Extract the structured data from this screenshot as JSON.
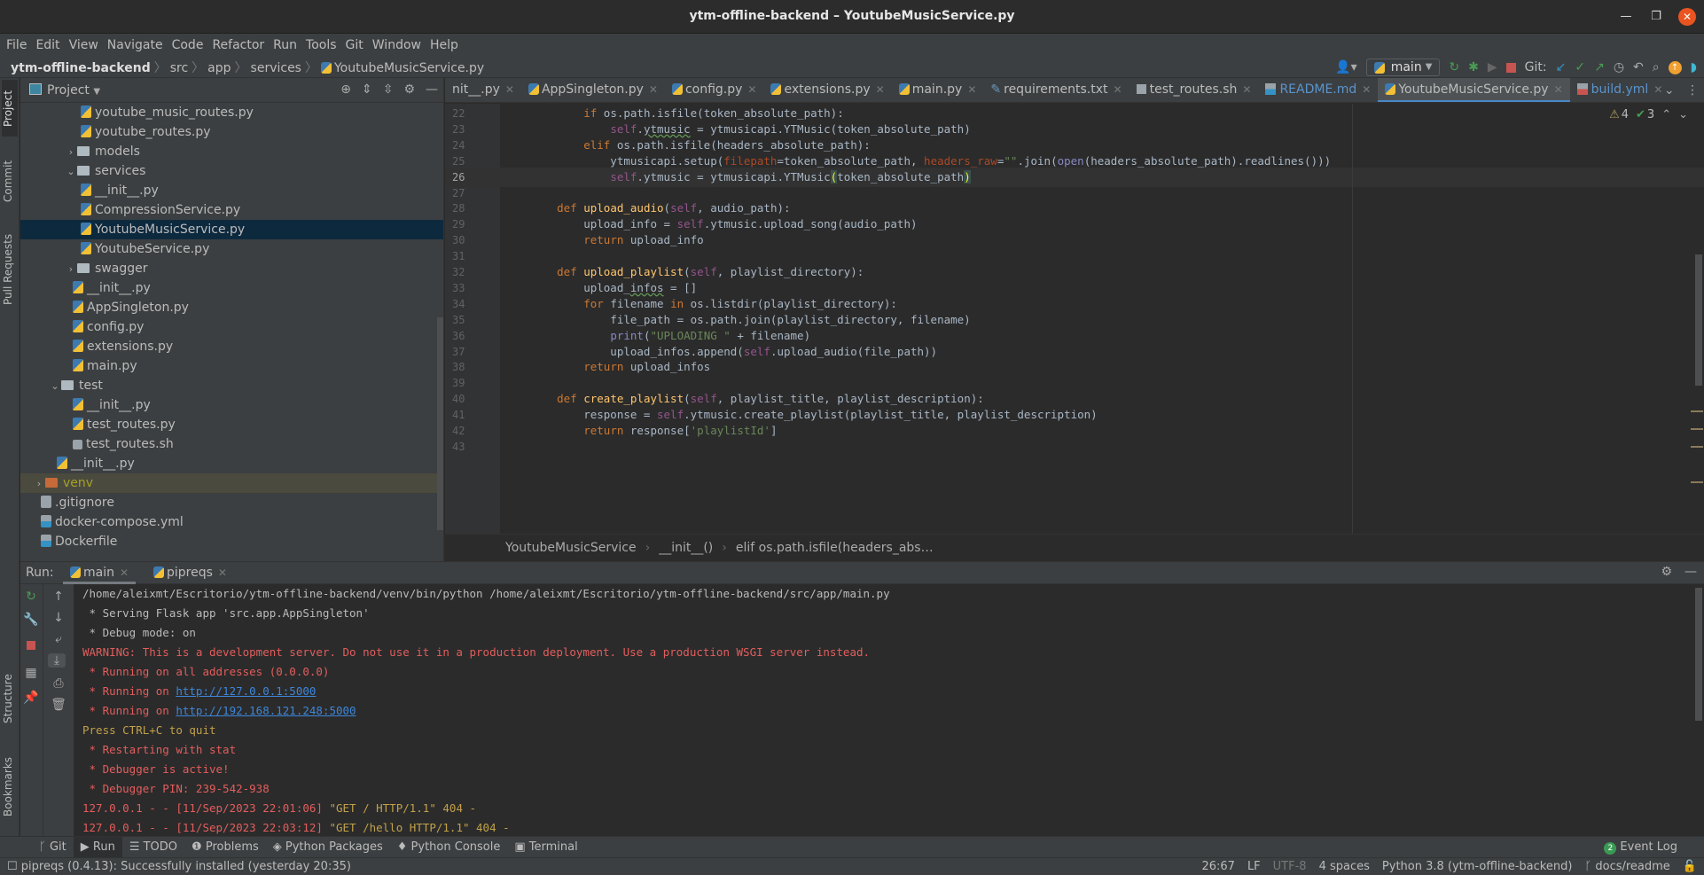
{
  "window": {
    "title": "ytm-offline-backend – YoutubeMusicService.py"
  },
  "menu": [
    "File",
    "Edit",
    "View",
    "Navigate",
    "Code",
    "Refactor",
    "Run",
    "Tools",
    "Git",
    "Window",
    "Help"
  ],
  "breadcrumb": {
    "project": "ytm-offline-backend",
    "parts": [
      "src",
      "app",
      "services"
    ],
    "file": "YoutubeMusicService.py"
  },
  "toolbar": {
    "run_config": "main",
    "git_label": "Git:"
  },
  "left_strip": {
    "top": [
      "Project",
      "Commit",
      "Pull Requests"
    ],
    "bottom": [
      "Structure",
      "Bookmarks"
    ]
  },
  "project_panel": {
    "title": "Project",
    "items": [
      {
        "label": "youtube_music_routes.py",
        "indent": 4,
        "type": "py"
      },
      {
        "label": "youtube_routes.py",
        "indent": 4,
        "type": "py"
      },
      {
        "label": "models",
        "indent": 3,
        "type": "folder",
        "expanded": false
      },
      {
        "label": "services",
        "indent": 3,
        "type": "folder",
        "expanded": true
      },
      {
        "label": "__init__.py",
        "indent": 4,
        "type": "py"
      },
      {
        "label": "CompressionService.py",
        "indent": 4,
        "type": "py"
      },
      {
        "label": "YoutubeMusicService.py",
        "indent": 4,
        "type": "py",
        "selected": true
      },
      {
        "label": "YoutubeService.py",
        "indent": 4,
        "type": "py"
      },
      {
        "label": "swagger",
        "indent": 3,
        "type": "folder",
        "expanded": false
      },
      {
        "label": "__init__.py",
        "indent": 3.5,
        "type": "py"
      },
      {
        "label": "AppSingleton.py",
        "indent": 3.5,
        "type": "py"
      },
      {
        "label": "config.py",
        "indent": 3.5,
        "type": "py"
      },
      {
        "label": "extensions.py",
        "indent": 3.5,
        "type": "py"
      },
      {
        "label": "main.py",
        "indent": 3.5,
        "type": "py"
      },
      {
        "label": "test",
        "indent": 2,
        "type": "folder",
        "expanded": true
      },
      {
        "label": "__init__.py",
        "indent": 3.5,
        "type": "py"
      },
      {
        "label": "test_routes.py",
        "indent": 3.5,
        "type": "py"
      },
      {
        "label": "test_routes.sh",
        "indent": 3.5,
        "type": "sh"
      },
      {
        "label": "__init__.py",
        "indent": 2.5,
        "type": "py"
      },
      {
        "label": "venv",
        "indent": 1,
        "type": "venv",
        "expanded": false
      },
      {
        "label": ".gitignore",
        "indent": 1.5,
        "type": "gray"
      },
      {
        "label": "docker-compose.yml",
        "indent": 1.5,
        "type": "dc"
      },
      {
        "label": "Dockerfile",
        "indent": 1.5,
        "type": "dc"
      }
    ]
  },
  "editor_tabs": [
    {
      "label": "__init__.py",
      "display": "nit__.py"
    },
    {
      "label": "AppSingleton.py"
    },
    {
      "label": "config.py"
    },
    {
      "label": "extensions.py"
    },
    {
      "label": "main.py"
    },
    {
      "label": "requirements.txt"
    },
    {
      "label": "test_routes.sh"
    },
    {
      "label": "README.md",
      "kind": "md"
    },
    {
      "label": "YoutubeMusicService.py",
      "active": true
    },
    {
      "label": "build.yml",
      "kind": "yml"
    }
  ],
  "inspections": {
    "warnings": "4",
    "weak_warnings": "3"
  },
  "code_lines": [
    {
      "n": "22",
      "html": "        <span class=\"kw\">if</span> os.path.isfile(token_absolute_path):"
    },
    {
      "n": "23",
      "html": "            <span class=\"sf\">self</span>.<span class=\"squig\">ytmusic</span> = ytmusicapi.YTMusic(token_absolute_path)"
    },
    {
      "n": "24",
      "html": "        <span class=\"kw\">elif</span> os.path.isfile(headers_absolute_path):"
    },
    {
      "n": "25",
      "html": "            ytmusicapi.setup(<span class=\"pm\">filepath</span>=token_absolute_path, <span class=\"pm\">headers_raw</span>=<span class=\"st\">\"\"</span>.join(<span class=\"bi\">open</span>(headers_absolute_path).readlines()))"
    },
    {
      "n": "26",
      "html": "            <span class=\"sf\">self</span>.ytmusic = ytmusicapi.YTMusic<span class=\"hl\">(</span>token_absolute_path<span class=\"hl\">)</span>",
      "current": true
    },
    {
      "n": "27",
      "html": ""
    },
    {
      "n": "28",
      "html": "    <span class=\"kw\">def</span> <span class=\"fn\">upload_audio</span>(<span class=\"sf\">self</span>, audio_path):"
    },
    {
      "n": "29",
      "html": "        upload_info = <span class=\"sf\">self</span>.ytmusic.upload_song(audio_path)"
    },
    {
      "n": "30",
      "html": "        <span class=\"kw\">return</span> upload_info"
    },
    {
      "n": "31",
      "html": ""
    },
    {
      "n": "32",
      "html": "    <span class=\"kw\">def</span> <span class=\"fn\">upload_playlist</span>(<span class=\"sf\">self</span>, playlist_directory):"
    },
    {
      "n": "33",
      "html": "        upload_<span class=\"squig\">infos</span> = []"
    },
    {
      "n": "34",
      "html": "        <span class=\"kw\">for</span> filename <span class=\"kw\">in</span> os.listdir(playlist_directory):"
    },
    {
      "n": "35",
      "html": "            file_path = os.path.join(playlist_directory, filename)"
    },
    {
      "n": "36",
      "html": "            <span class=\"bi\">print</span>(<span class=\"st\">\"UPLOADING \"</span> + filename)"
    },
    {
      "n": "37",
      "html": "            upload_infos.append(<span class=\"sf\">self</span>.upload_audio(file_path))"
    },
    {
      "n": "38",
      "html": "        <span class=\"kw\">return</span> upload_infos"
    },
    {
      "n": "39",
      "html": ""
    },
    {
      "n": "40",
      "html": "    <span class=\"kw\">def</span> <span class=\"fn\">create_playlist</span>(<span class=\"sf\">self</span>, playlist_title, playlist_description):"
    },
    {
      "n": "41",
      "html": "        response = <span class=\"sf\">self</span>.ytmusic.create_playlist(playlist_title, playlist_description)"
    },
    {
      "n": "42",
      "html": "        <span class=\"kw\">return</span> response[<span class=\"st\">'playlistId'</span>]"
    },
    {
      "n": "43",
      "html": ""
    }
  ],
  "editor_breadcrumb": [
    "YoutubeMusicService",
    "__init__()",
    "elif os.path.isfile(headers_abs…"
  ],
  "run_panel": {
    "label": "Run:",
    "tabs": [
      {
        "label": "main",
        "active": true
      },
      {
        "label": "pipreqs"
      }
    ],
    "output": [
      {
        "cls": "o-def",
        "text": "/home/aleixmt/Escritorio/ytm-offline-backend/venv/bin/python /home/aleixmt/Escritorio/ytm-offline-backend/src/app/main.py"
      },
      {
        "cls": "o-def",
        "text": " * Serving Flask app 'src.app.AppSingleton'"
      },
      {
        "cls": "o-def",
        "text": " * Debug mode: on"
      },
      {
        "cls": "o-red",
        "text": "WARNING: This is a development server. Do not use it in a production deployment. Use a production WSGI server instead."
      },
      {
        "cls": "o-red",
        "text": " * Running on all addresses (0.0.0.0)"
      },
      {
        "cls": "o-red",
        "text": " * Running on ",
        "link": "http://127.0.0.1:5000"
      },
      {
        "cls": "o-red",
        "text": " * Running on ",
        "link": "http://192.168.121.248:5000"
      },
      {
        "cls": "o-ylw",
        "text": "Press CTRL+C to quit"
      },
      {
        "cls": "o-red",
        "text": " * Restarting with stat"
      },
      {
        "cls": "o-red",
        "text": " * Debugger is active!"
      },
      {
        "cls": "o-red",
        "text": " * Debugger PIN: 239-542-938"
      },
      {
        "cls": "o-red",
        "text": "127.0.0.1 - - [11/Sep/2023 22:01:06] ",
        "tail": "\"GET / HTTP/1.1\" 404 -"
      },
      {
        "cls": "o-red",
        "text": "127.0.0.1 - - [11/Sep/2023 22:03:12] ",
        "tail": "\"GET /hello HTTP/1.1\" 404 -"
      }
    ]
  },
  "bottom_tabs": [
    "Git",
    "Run",
    "TODO",
    "Problems",
    "Python Packages",
    "Python Console",
    "Terminal"
  ],
  "event_log": {
    "count": "2",
    "label": "Event Log"
  },
  "status": {
    "message": "pipreqs (0.4.13): Successfully installed (yesterday 20:35)",
    "position": "26:67",
    "line_sep": "LF",
    "encoding": "UTF-8",
    "indent": "4 spaces",
    "interpreter": "Python 3.8 (ytm-offline-backend)",
    "branch": "docs/readme"
  }
}
